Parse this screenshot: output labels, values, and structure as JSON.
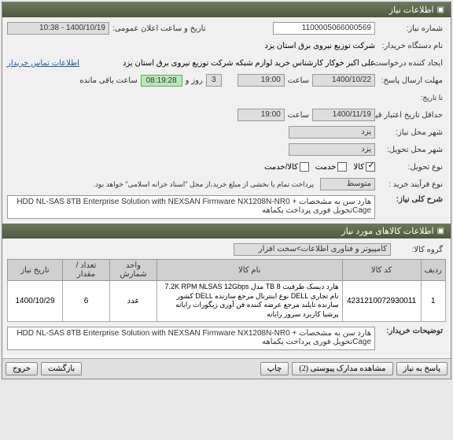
{
  "header": {
    "title": "اطلاعات نیاز"
  },
  "form": {
    "need_no_label": "شماره نیاز:",
    "need_no": "1100005066000569",
    "public_dt_label": "تاریخ و ساعت اعلان عمومی:",
    "public_dt": "1400/10/19 - 10:38",
    "buyer_org_label": "نام دستگاه خریدار:",
    "buyer_org": "شرکت توزیع نیروی برق استان یزد",
    "requester_label": "ایجاد کننده درخواست:",
    "requester": "علی اکبر خوکار  کارشناس خرید لوازم شبکه  شرکت توزیع نیروی برق استان یزد",
    "buyer_contact_link": "اطلاعات تماس خریدار",
    "deadline_label": "مهلت ارسال پاسخ:",
    "deadline_until": "تا تاریخ:",
    "deadline_date": "1400/10/22",
    "time_label": "ساعت",
    "deadline_time": "19:00",
    "countdown": "08:19:28",
    "days": "3",
    "days_suffix": "روز و",
    "remaining": "ساعت باقی مانده",
    "validity_label": "حداقل تاریخ اعتبار قیمت تا:",
    "validity_date": "1400/11/19",
    "validity_time": "19:00",
    "need_city_label": "شهر محل نیاز:",
    "need_city": "یزد",
    "delivery_city_label": "شهر محل تحویل:",
    "delivery_city": "یزد",
    "delivery_type_label": "نوع تحویل:",
    "goods": "کالا",
    "service": "خدمت",
    "goods_service": "کالا/خدمت",
    "purchase_type_label": "نوع فرآیند خرید :",
    "purchase_note": "پرداخت تمام یا بخشی از مبلغ خرید،از محل \"اسناد خزانه اسلامی\" خواهد بود.",
    "need_mid": "متوسط",
    "summary_label": "شرح کلی نیاز:",
    "summary": "هارد سن به مشخصات  HDD NL-SAS 8TB Enterprise Solution with NEXSAN Firmware NX1208N-NR0 + Cageتحویل فوری پرداخت یکماهه"
  },
  "items_header": {
    "title": "اطلاعات کالاهای مورد نیاز",
    "group_label": "گروه کالا:",
    "group": "کامپیوتر و فناوری اطلاعات>سخت افزار"
  },
  "table": {
    "cols": [
      "ردیف",
      "کد کالا",
      "نام کالا",
      "واحد شمارش",
      "تعداد / مقدار",
      "تاریخ نیاز"
    ],
    "rows": [
      {
        "idx": "1",
        "code": "4231210072930011",
        "name": "هارد دیسک ظرفیت TB 8 مدل 7.2K RPM NLSAS 12Gbps نام تجاری DELL نوع اینترنال مرجع سازنده DELL کشور سازنده تایلند مرجع عرضه کننده فن آوری زیگورات رایانه پرشیا کاربرد سرور رایانه",
        "unit": "عدد",
        "qty": "6",
        "date": "1400/10/29"
      }
    ]
  },
  "buyer_notes_label": "توضیحات خریدار:",
  "buyer_notes": "هارد سن به مشخصات  HDD NL-SAS 8TB Enterprise Solution with NEXSAN Firmware NX1208N-NR0 + Cageتحویل فوری پرداخت یکماهه",
  "buttons": {
    "respond": "پاسخ به نیاز",
    "attachments": "مشاهده مدارک پیوستی (2)",
    "print": "چاپ",
    "back": "بازگشت",
    "exit": "خروج"
  }
}
